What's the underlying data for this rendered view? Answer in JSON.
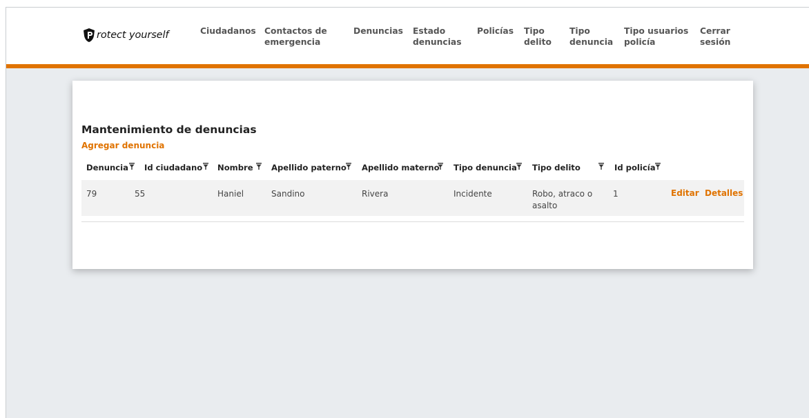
{
  "brand": {
    "letter": "P",
    "rest": "rotect yourself"
  },
  "nav": {
    "ciudadanos": "Ciudadanos",
    "contactos_1": "Contactos de",
    "contactos_2": "emergencia",
    "denuncias": "Denuncias",
    "estado_1": "Estado",
    "estado_2": "denuncias",
    "policias": "Policías",
    "tipo_delito_1": "Tipo",
    "tipo_delito_2": "delito",
    "tipo_denuncia_1": "Tipo",
    "tipo_denuncia_2": "denuncia",
    "tipo_usuarios_1": "Tipo usuarios",
    "tipo_usuarios_2": "policía",
    "cerrar_1": "Cerrar",
    "cerrar_2": "sesión"
  },
  "page": {
    "title": "Mantenimiento de denuncias",
    "add_link": "Agregar denuncia"
  },
  "table": {
    "columns": [
      "Denuncia",
      "Id ciudadano",
      "Nombre",
      "Apellido paterno",
      "Apellido materno",
      "Tipo denuncia",
      "Tipo delito",
      "Id policía"
    ],
    "rows": [
      {
        "denuncia": "79",
        "id_ciudadano": "55",
        "nombre": "Haniel",
        "apellido_paterno": "Sandino",
        "apellido_materno": "Rivera",
        "tipo_denuncia": "Incidente",
        "tipo_delito_1": "Robo, atraco o",
        "tipo_delito_2": "asalto",
        "id_policia": "1",
        "edit_label": "Editar",
        "details_label": "Detalles"
      }
    ]
  },
  "icons": {
    "filter": "filter-icon",
    "logo": "shield-p-logo"
  },
  "colors": {
    "accent": "#e07300",
    "background": "#e9ecef",
    "row": "#f2f2f2"
  }
}
